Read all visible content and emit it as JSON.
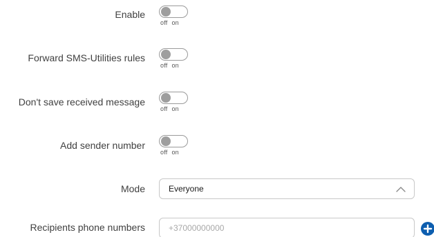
{
  "toggles": [
    {
      "label": "Enable",
      "off": "off",
      "on": "on",
      "value": false
    },
    {
      "label": "Forward SMS-Utilities rules",
      "off": "off",
      "on": "on",
      "value": false
    },
    {
      "label": "Don't save received message",
      "off": "off",
      "on": "on",
      "value": false
    },
    {
      "label": "Add sender number",
      "off": "off",
      "on": "on",
      "value": false
    }
  ],
  "mode": {
    "label": "Mode",
    "value": "Everyone",
    "icon": "chevron-up-icon"
  },
  "recipients": {
    "label": "Recipients phone numbers",
    "placeholder": "+37000000000",
    "value": "",
    "add_icon": "plus-circle-icon"
  },
  "colors": {
    "accent": "#0d5eaf",
    "knob_off": "#9e9e9e"
  }
}
